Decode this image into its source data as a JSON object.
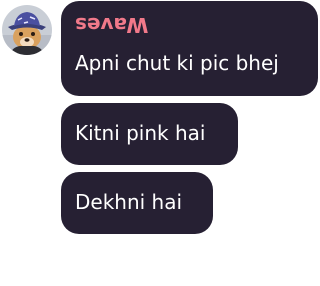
{
  "chat": {
    "sender_name": "Waves",
    "avatar_icon": "dog-wearing-bucket-hat-avatar",
    "messages": [
      {
        "text": "Apni chut ki pic bhej"
      },
      {
        "text": "Kitni pink hai"
      },
      {
        "text": "Dekhni hai"
      }
    ]
  },
  "colors": {
    "bubble_bg": "#262033",
    "sender_name": "#f1798a",
    "message_text": "#ffffff",
    "page_bg": "#ffffff"
  }
}
